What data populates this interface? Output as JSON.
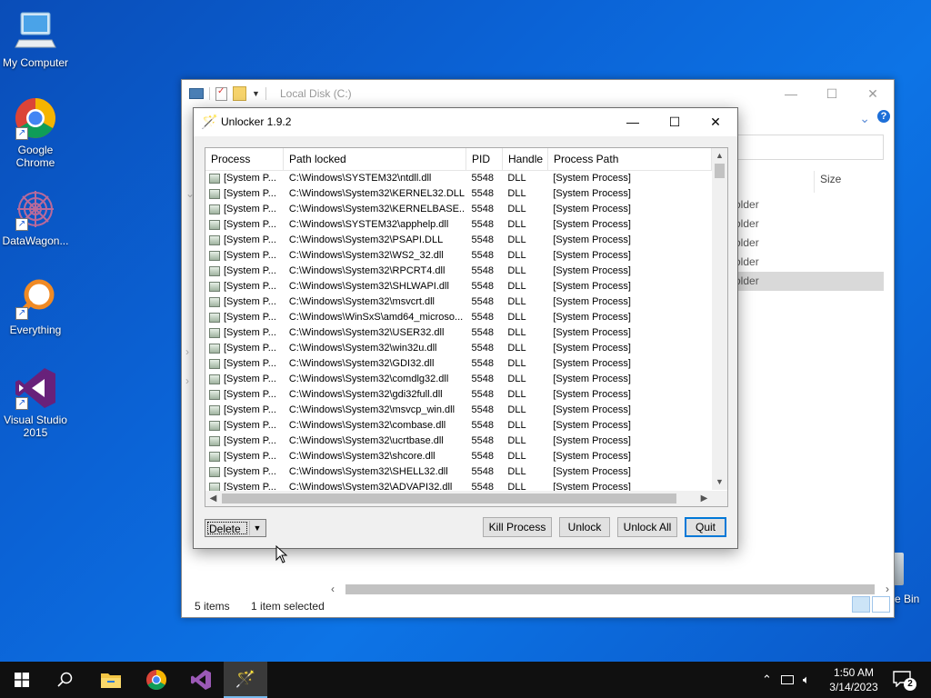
{
  "desktop": {
    "icons": [
      {
        "label": "My Computer"
      },
      {
        "label": "Google Chrome"
      },
      {
        "label": "DataWagon..."
      },
      {
        "label": "Everything"
      },
      {
        "label": "Visual Studio 2015"
      }
    ],
    "recycle_label": "e Bin"
  },
  "explorer": {
    "title": "Local Disk (C:)",
    "column_size": "Size",
    "items": [
      "older",
      "older",
      "older",
      "older",
      "older"
    ],
    "status_items": "5 items",
    "status_selected": "1 item selected"
  },
  "unlocker": {
    "title": "Unlocker 1.9.2",
    "columns": [
      "Process",
      "Path locked",
      "PID",
      "Handle",
      "Process Path"
    ],
    "rows": [
      [
        "[System P...",
        "C:\\Windows\\SYSTEM32\\ntdll.dll",
        "5548",
        "DLL",
        "[System Process]"
      ],
      [
        "[System P...",
        "C:\\Windows\\System32\\KERNEL32.DLL",
        "5548",
        "DLL",
        "[System Process]"
      ],
      [
        "[System P...",
        "C:\\Windows\\System32\\KERNELBASE...",
        "5548",
        "DLL",
        "[System Process]"
      ],
      [
        "[System P...",
        "C:\\Windows\\SYSTEM32\\apphelp.dll",
        "5548",
        "DLL",
        "[System Process]"
      ],
      [
        "[System P...",
        "C:\\Windows\\System32\\PSAPI.DLL",
        "5548",
        "DLL",
        "[System Process]"
      ],
      [
        "[System P...",
        "C:\\Windows\\System32\\WS2_32.dll",
        "5548",
        "DLL",
        "[System Process]"
      ],
      [
        "[System P...",
        "C:\\Windows\\System32\\RPCRT4.dll",
        "5548",
        "DLL",
        "[System Process]"
      ],
      [
        "[System P...",
        "C:\\Windows\\System32\\SHLWAPI.dll",
        "5548",
        "DLL",
        "[System Process]"
      ],
      [
        "[System P...",
        "C:\\Windows\\System32\\msvcrt.dll",
        "5548",
        "DLL",
        "[System Process]"
      ],
      [
        "[System P...",
        "C:\\Windows\\WinSxS\\amd64_microso...",
        "5548",
        "DLL",
        "[System Process]"
      ],
      [
        "[System P...",
        "C:\\Windows\\System32\\USER32.dll",
        "5548",
        "DLL",
        "[System Process]"
      ],
      [
        "[System P...",
        "C:\\Windows\\System32\\win32u.dll",
        "5548",
        "DLL",
        "[System Process]"
      ],
      [
        "[System P...",
        "C:\\Windows\\System32\\GDI32.dll",
        "5548",
        "DLL",
        "[System Process]"
      ],
      [
        "[System P...",
        "C:\\Windows\\System32\\comdlg32.dll",
        "5548",
        "DLL",
        "[System Process]"
      ],
      [
        "[System P...",
        "C:\\Windows\\System32\\gdi32full.dll",
        "5548",
        "DLL",
        "[System Process]"
      ],
      [
        "[System P...",
        "C:\\Windows\\System32\\msvcp_win.dll",
        "5548",
        "DLL",
        "[System Process]"
      ],
      [
        "[System P...",
        "C:\\Windows\\System32\\combase.dll",
        "5548",
        "DLL",
        "[System Process]"
      ],
      [
        "[System P...",
        "C:\\Windows\\System32\\ucrtbase.dll",
        "5548",
        "DLL",
        "[System Process]"
      ],
      [
        "[System P...",
        "C:\\Windows\\System32\\shcore.dll",
        "5548",
        "DLL",
        "[System Process]"
      ],
      [
        "[System P...",
        "C:\\Windows\\System32\\SHELL32.dll",
        "5548",
        "DLL",
        "[System Process]"
      ],
      [
        "[System P...",
        "C:\\Windows\\System32\\ADVAPI32.dll",
        "5548",
        "DLL",
        "[System Process]"
      ]
    ],
    "action_select": "Delete",
    "buttons": {
      "kill": "Kill Process",
      "unlock": "Unlock",
      "unlock_all": "Unlock All",
      "quit": "Quit"
    }
  },
  "taskbar": {
    "time": "1:50 AM",
    "date": "3/14/2023",
    "notification_count": "2",
    "pinned_icons": [
      "start-icon",
      "search-icon",
      "file-explorer-icon",
      "chrome-icon",
      "visual-studio-icon",
      "unlocker-icon"
    ]
  }
}
